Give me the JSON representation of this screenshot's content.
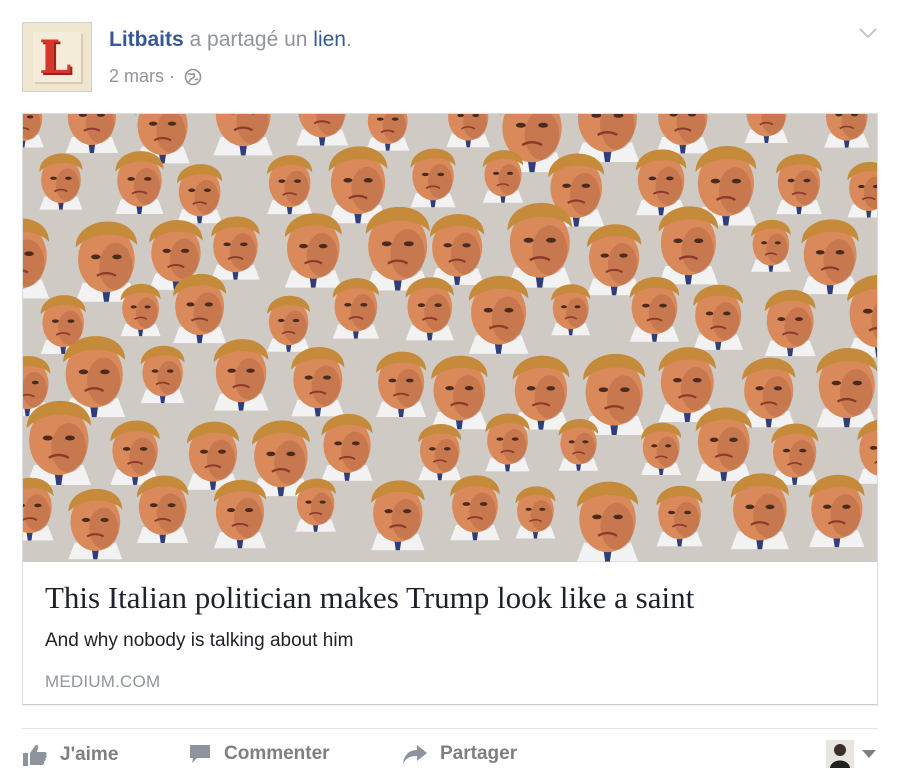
{
  "post": {
    "page_name": "Litbaits",
    "action_text": " a partagé un ",
    "link_word": "lien",
    "trailing_punct": ".",
    "date": "2 mars",
    "separator": " · ",
    "privacy_icon": "globe-icon",
    "menu_icon": "chevron-down-icon",
    "avatar_letter": "L"
  },
  "link_card": {
    "image_description_icon": "photo-collage",
    "title": "This Italian politician makes Trump look like a saint",
    "subtitle": "And why nobody is talking about him",
    "domain": "MEDIUM.COM"
  },
  "actions": {
    "like_label": "J'aime",
    "like_icon": "thumbs-up-icon",
    "comment_label": "Commenter",
    "comment_icon": "speech-bubble-icon",
    "share_label": "Partager",
    "share_icon": "share-arrow-icon",
    "audience_icon": "caret-down-icon"
  },
  "colors": {
    "link_blue": "#365899",
    "meta_gray": "#90949c",
    "action_gray": "#7f7f7f",
    "text_dark": "#1d2129"
  }
}
